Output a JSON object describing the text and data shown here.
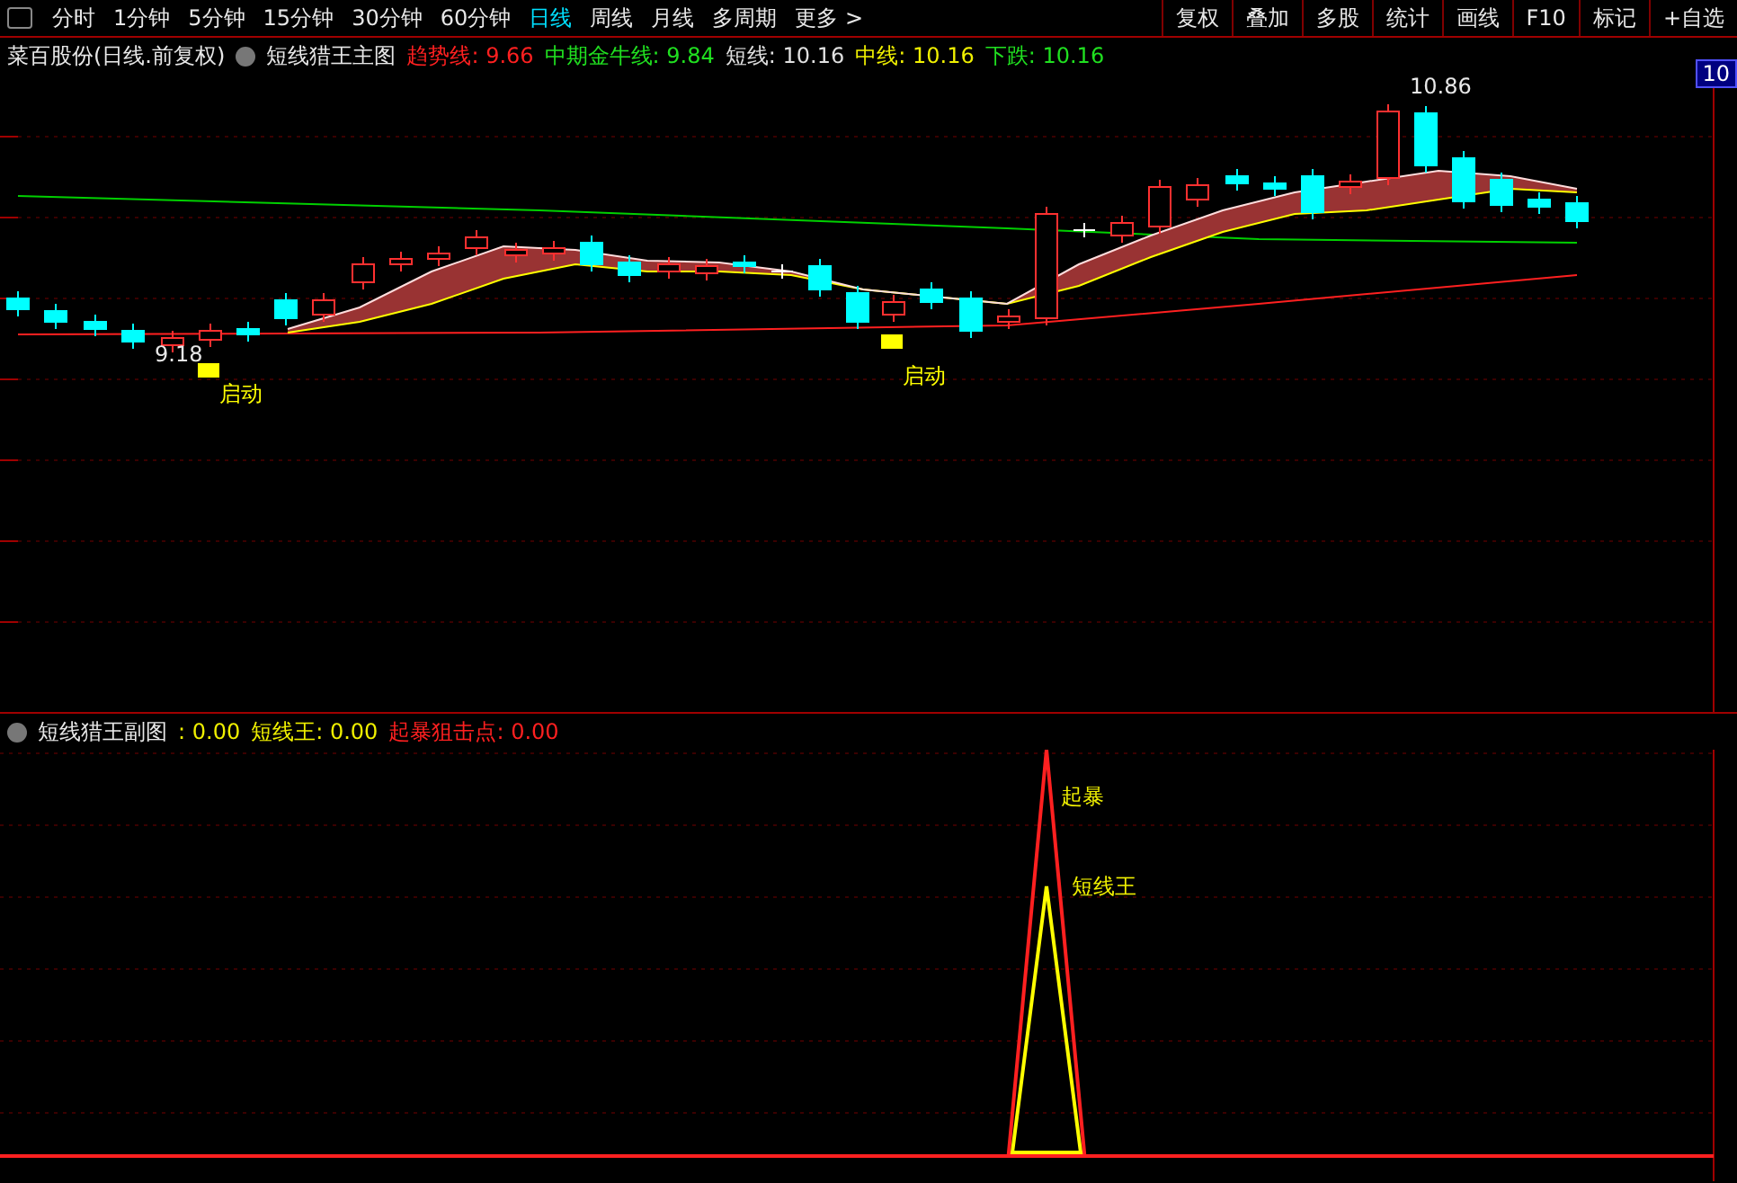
{
  "toolbar": {
    "periods": [
      {
        "label": "分时",
        "selected": false
      },
      {
        "label": "1分钟",
        "selected": false
      },
      {
        "label": "5分钟",
        "selected": false
      },
      {
        "label": "15分钟",
        "selected": false
      },
      {
        "label": "30分钟",
        "selected": false
      },
      {
        "label": "60分钟",
        "selected": false
      },
      {
        "label": "日线",
        "selected": true
      },
      {
        "label": "周线",
        "selected": false
      },
      {
        "label": "月线",
        "selected": false
      },
      {
        "label": "多周期",
        "selected": false
      },
      {
        "label": "更多 >",
        "selected": false
      }
    ],
    "actions": [
      "复权",
      "叠加",
      "多股",
      "统计",
      "画线",
      "F10",
      "标记",
      "+自选"
    ]
  },
  "main_chart": {
    "title": "菜百股份(日线.前复权)",
    "indicator": "短线猎王主图",
    "legend": [
      {
        "label": "趋势线:",
        "value": "9.66",
        "color": "#ff2020"
      },
      {
        "label": "中期金牛线:",
        "value": "9.84",
        "color": "#20e020"
      },
      {
        "label": "短线:",
        "value": "10.16",
        "color": "#e0e0e0"
      },
      {
        "label": "中线:",
        "value": "10.16",
        "color": "#f0f000"
      },
      {
        "label": "下跌:",
        "value": "10.16",
        "color": "#20e020"
      }
    ],
    "high_label": "10.86",
    "low_label": "9.18",
    "signals": [
      "启动",
      "启动"
    ],
    "axis_price": "10"
  },
  "sub_chart": {
    "indicator": "短线猎王副图",
    "legend": [
      {
        "label": ":",
        "value": "0.00",
        "color": "#f0f000"
      },
      {
        "label": "短线王:",
        "value": "0.00",
        "color": "#f0f000"
      },
      {
        "label": "起暴狙击点:",
        "value": "0.00",
        "color": "#ff2020"
      }
    ],
    "peak_labels": [
      {
        "text": "起暴",
        "color": "#f0f000"
      },
      {
        "text": "短线王",
        "color": "#f0f000"
      }
    ]
  }
}
